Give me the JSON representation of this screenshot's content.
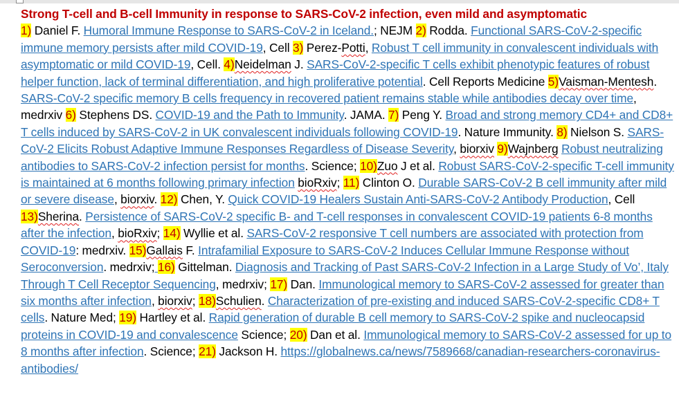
{
  "document": {
    "title": "Strong T-cell and B-cell Immunity in response to SARS-CoV-2 infection, even mild and asymptomatic",
    "colors": {
      "title": "#c00000",
      "link": "#2e74b5",
      "highlight": "#ffff00",
      "number": "#c00000",
      "spellcheck": "#e02020"
    },
    "refs": [
      {
        "num": "1)",
        "author": " Daniel F.  ",
        "link": "Humoral Immune Response to SARS-CoV-2 in Iceland.",
        "source": "; NEJM "
      },
      {
        "num": "2)",
        "author": " Rodda.  ",
        "link": "Functional SARS-CoV-2-specific immune memory persists after mild COVID-19",
        "source": ", Cell "
      },
      {
        "num": "3)",
        "author_pre": "  Perez-",
        "author_sq": "Potti",
        "author_post": ", ",
        "link": "Robust T cell immunity in convalescent individuals with asymptomatic or mild COVID-19",
        "source": ", Cell. "
      },
      {
        "num": "4)",
        "author_sq": "Neidelman",
        "author_post": " J. ",
        "link": "SARS-CoV-2-specific T cells exhibit phenotypic features of robust helper function, lack of terminal differentiation, and high proliferative potential",
        "source": ". Cell Reports Medicine "
      },
      {
        "num": "5)",
        "author_sq": "Vaisman-Mentesh",
        "author_post": ". ",
        "link": "SARS-CoV-2 specific memory B cells frequency in recovered patient remains stable while antibodies decay over time",
        "source": ", medrxiv "
      },
      {
        "num": "6)",
        "author": " Stephens DS. ",
        "link": "COVID-19 and the Path to Immunity",
        "source": ". JAMA. "
      },
      {
        "num": "7)",
        "author": " Peng Y. ",
        "link": "Broad and strong memory CD4+ and CD8+ T cells induced by SARS-CoV-2 in UK convalescent individuals following COVID-19",
        "source": ". Nature Immunity. "
      },
      {
        "num": "8)",
        "author": " Nielson S.  ",
        "link": "SARS-CoV-2 Elicits Robust Adaptive Immune Responses Regardless of Disease Severity",
        "source_pre": ", ",
        "source_sq": "biorxiv",
        "source_post": " "
      },
      {
        "num": "9)",
        "author_sq": "Wajnberg",
        "author_post": "  ",
        "link": "Robust neutralizing antibodies to SARS-CoV-2 infection persist for months",
        "source": ". Science; "
      },
      {
        "num": "10)",
        "author_sq": "Zuo",
        "author_post": " J et al.  ",
        "link": "Robust SARS-CoV-2-specific T-cell immunity is maintained at 6 months following primary infection",
        "source_pre": " ",
        "source_sq": "bioRxiv",
        "source_post": "; "
      },
      {
        "num": "11)",
        "author": " Clinton O. ",
        "link": "Durable SARS-CoV-2 B cell immunity after mild or severe disease",
        "source_pre": ", ",
        "source_sq": "biorxiv",
        "source_post": ". "
      },
      {
        "num": "12)",
        "author": " Chen, Y. ",
        "link": "Quick COVID-19 Healers Sustain Anti-SARS-CoV-2 Antibody Production",
        "source": ", Cell  "
      },
      {
        "num": "13)",
        "author_sq": "Sherina",
        "author_post": ". ",
        "link": "Persistence of SARS-CoV-2 specific B- and T-cell responses in convalescent COVID-19 patients 6-8 months after the infection",
        "source_pre": ", ",
        "source_sq": "bioRxiv",
        "source_post": "; "
      },
      {
        "num": "14)",
        "author": " Wyllie et al. ",
        "link": "SARS-CoV-2 responsive T cell numbers are associated with protection from COVID-19",
        "source": ": medrxiv. "
      },
      {
        "num": "15)",
        "author_sq": "Gallais",
        "author_post": " F. ",
        "link": "Intrafamilial Exposure to SARS-CoV-2 Induces Cellular Immune Response without Seroconversion",
        "source": ". medrxiv"
      },
      {
        "num": "16)",
        "num_pre": "; ",
        "author": " Gittelman. ",
        "link": "Diagnosis and Tracking of Past SARS-CoV-2 Infection in a Large Study of Vo’, Italy Through T Cell Receptor Sequencing",
        "source": ", medrxiv; "
      },
      {
        "num": "17)",
        "author": " Dan. ",
        "link": "Immunological memory to SARS-CoV-2 assessed for greater than six months after infection",
        "source_pre": ", ",
        "source_sq": "biorxiv",
        "source_post": "; "
      },
      {
        "num": "18)",
        "author_sq": "Schulien",
        "author_post": ". ",
        "link": "Characterization of pre-existing and induced SARS-CoV-2-specific CD8+ T cells",
        "source": ". Nature Med; "
      },
      {
        "num": "19)",
        "author": " Hartley et al. ",
        "link": "Rapid generation of durable B cell memory to SARS-CoV-2 spike and nucleocapsid proteins in COVID-19 and convalescence",
        "source": " Science; "
      },
      {
        "num": "20)",
        "author": " Dan et al. ",
        "link": "Immunological memory to SARS-CoV-2 assessed for up to 8 months after infection",
        "source": ". Science; "
      },
      {
        "num": "21)",
        "author": " Jackson H. ",
        "link": "https://globalnews.ca/news/7589668/canadian-researchers-coronavirus-antibodies/",
        "source": ""
      }
    ]
  }
}
